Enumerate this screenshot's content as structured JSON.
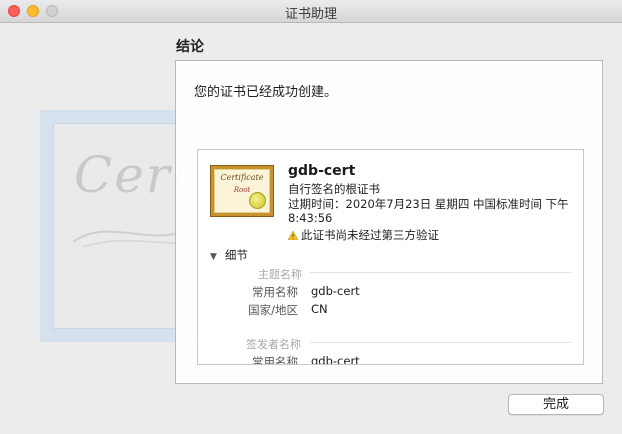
{
  "window": {
    "title": "证书助理"
  },
  "section": {
    "title": "结论"
  },
  "summary": "您的证书已经成功创建。",
  "background": {
    "script_text": "Certif"
  },
  "certificate": {
    "icon_title": "Certificate",
    "icon_subtitle": "Root",
    "name": "gdb-cert",
    "type": "自行签名的根证书",
    "expiration": "过期时间：2020年7月23日 星期四 中国标准时间 下午8:43:56",
    "warning": "此证书尚未经过第三方验证"
  },
  "details": {
    "toggle_label": "细节",
    "subject": {
      "label": "主题名称",
      "rows": [
        {
          "key": "常用名称",
          "value": "gdb-cert"
        },
        {
          "key": "国家/地区",
          "value": "CN"
        }
      ]
    },
    "issuer": {
      "label": "签发者名称",
      "rows": [
        {
          "key": "常用名称",
          "value": "gdb-cert"
        }
      ]
    }
  },
  "buttons": {
    "done": "完成"
  },
  "colors": {
    "close": "#fc5f57",
    "minimize": "#fdbc2e",
    "zoom": "#d0d0d0",
    "seal": "#e0dc45"
  }
}
